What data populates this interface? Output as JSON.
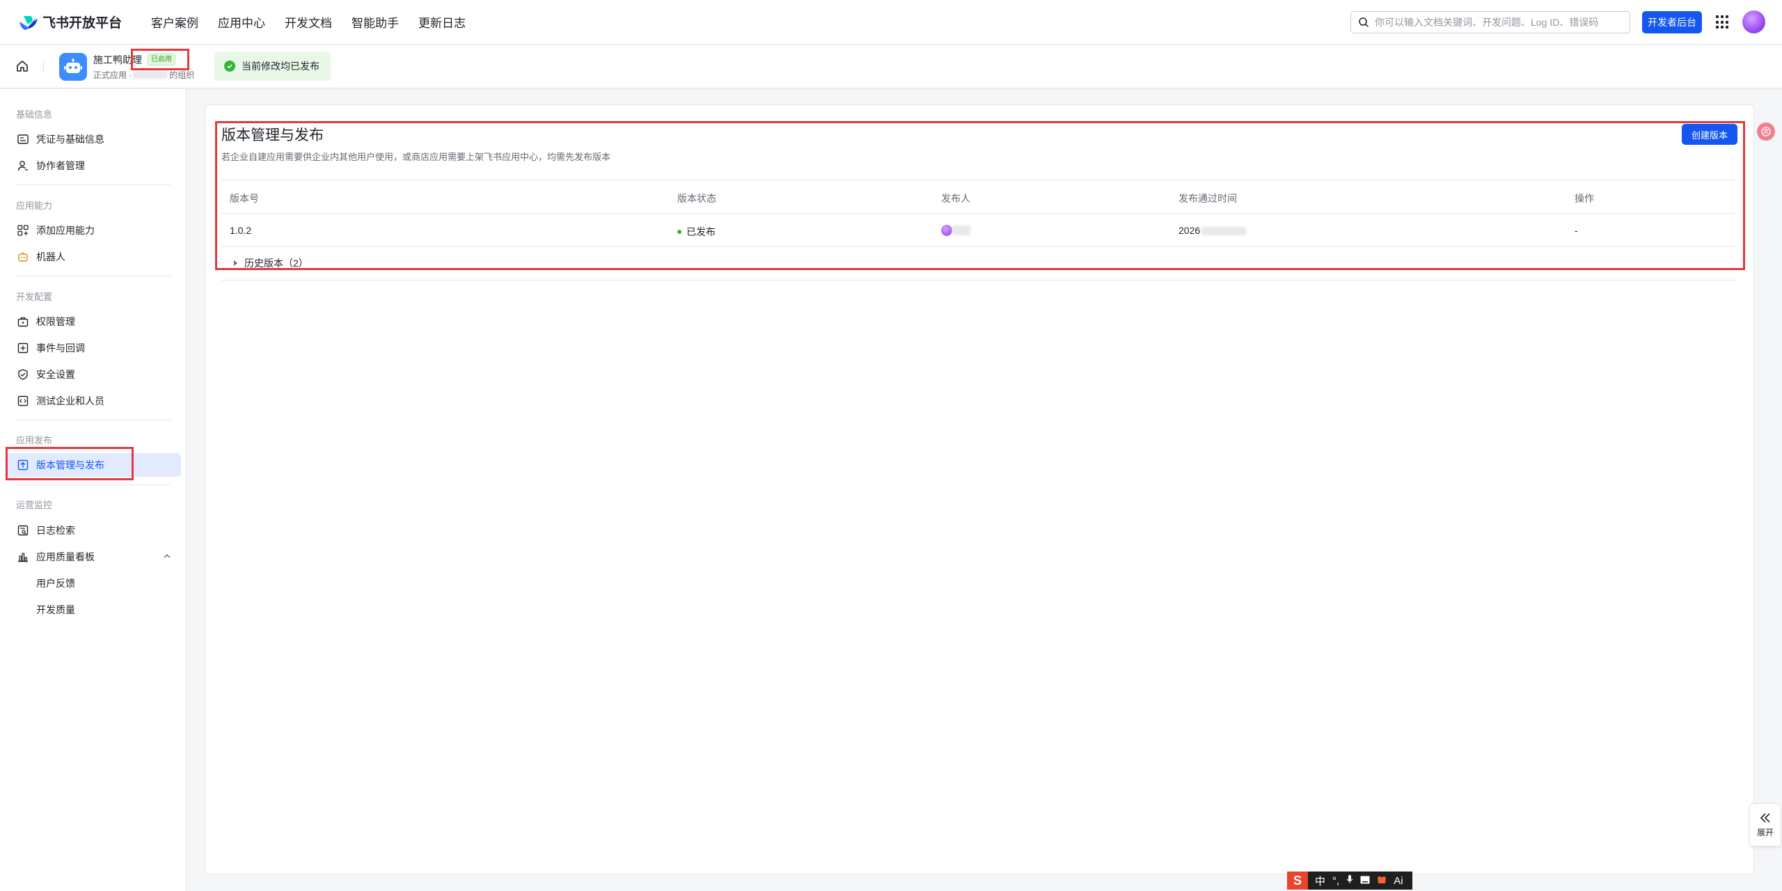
{
  "topnav": {
    "logo_text": "飞书开放平台",
    "items": [
      "客户案例",
      "应用中心",
      "开发文档",
      "智能助手",
      "更新日志"
    ],
    "search_placeholder": "你可以输入文档关键词、开发问题、Log ID、错误码",
    "dev_button": "开发者后台"
  },
  "app": {
    "name": "施工鸭助理",
    "badge": "已启用",
    "sub_prefix": "正式应用 ·",
    "sub_suffix": "的组织",
    "status": "当前修改均已发布"
  },
  "sidebar": {
    "groups": [
      {
        "title": "基础信息",
        "items": [
          "凭证与基础信息",
          "协作者管理"
        ]
      },
      {
        "title": "应用能力",
        "items": [
          "添加应用能力",
          "机器人"
        ]
      },
      {
        "title": "开发配置",
        "items": [
          "权限管理",
          "事件与回调",
          "安全设置",
          "测试企业和人员"
        ]
      },
      {
        "title": "应用发布",
        "items": [
          "版本管理与发布"
        ]
      },
      {
        "title": "运营监控",
        "items": [
          "日志检索",
          "应用质量看板"
        ],
        "subitems": [
          "用户反馈",
          "开发质量"
        ]
      }
    ]
  },
  "main": {
    "title": "版本管理与发布",
    "description": "若企业自建应用需要供企业内其他用户使用，或商店应用需要上架飞书应用中心，均需先发布版本",
    "create_button": "创建版本",
    "columns": [
      "版本号",
      "版本状态",
      "发布人",
      "发布通过时间",
      "操作"
    ],
    "rows": [
      {
        "version": "1.0.2",
        "status": "已发布",
        "time": "2026",
        "action": "-"
      }
    ],
    "history": "历史版本（2）"
  },
  "floating": {
    "expand": "展开",
    "ime": [
      "中",
      "Ai"
    ]
  },
  "colors": {
    "primary": "#1456f0",
    "highlight": "#e5383b",
    "success": "#34b53a",
    "active_bg": "#e1eaff"
  }
}
